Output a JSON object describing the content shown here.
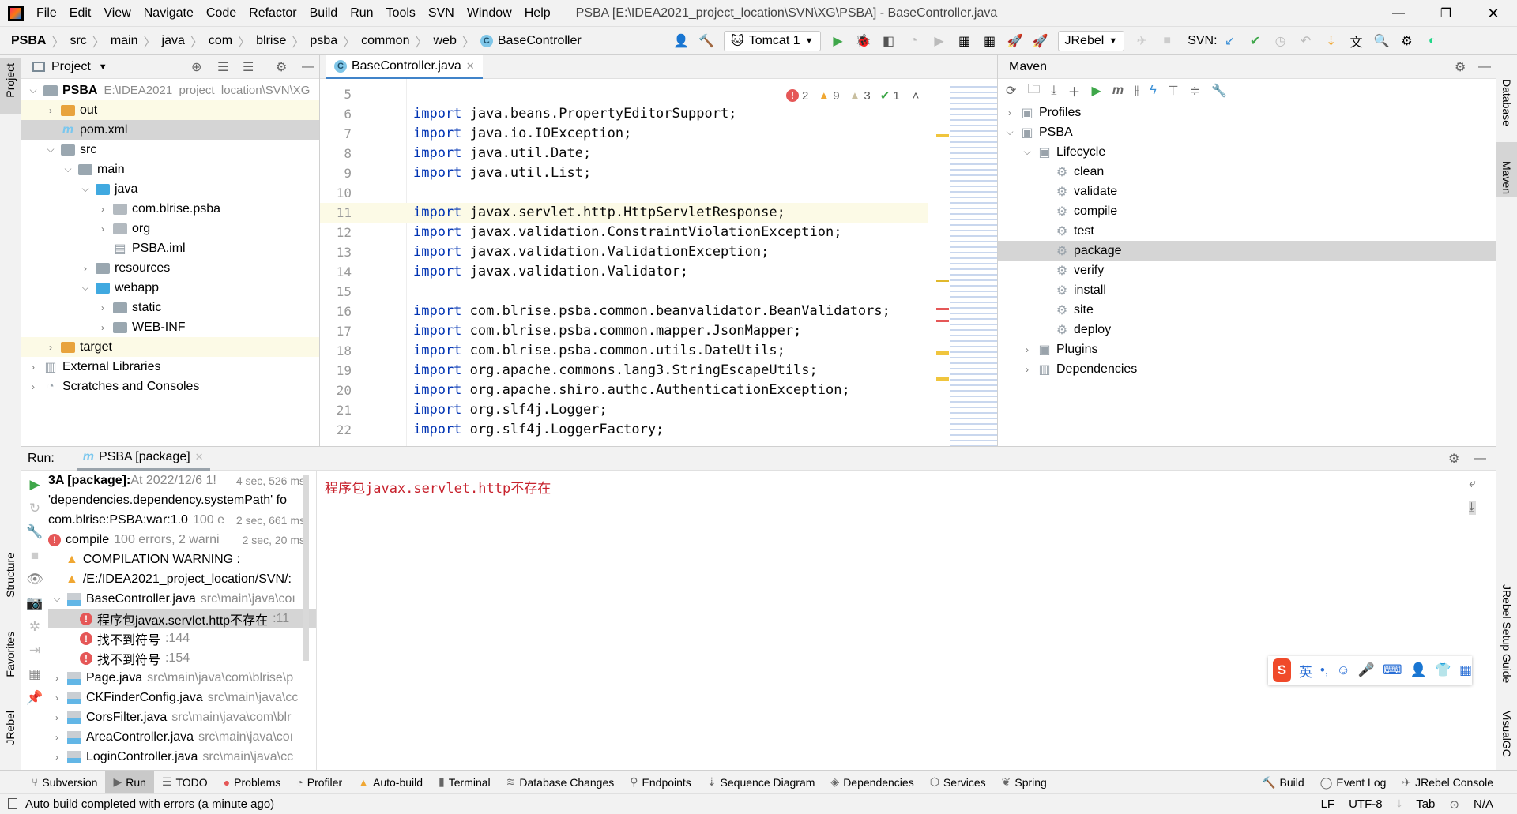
{
  "menu": {
    "items": [
      "File",
      "Edit",
      "View",
      "Navigate",
      "Code",
      "Refactor",
      "Build",
      "Run",
      "Tools",
      "SVN",
      "Window",
      "Help"
    ],
    "window_title": "PSBA [E:\\IDEA2021_project_location\\SVN\\XG\\PSBA] - BaseController.java"
  },
  "breadcrumb": [
    "PSBA",
    "src",
    "main",
    "java",
    "com",
    "blrise",
    "psba",
    "common",
    "web",
    "BaseController"
  ],
  "toolbar": {
    "run_config": "Tomcat 1",
    "jrebel": "JRebel",
    "svn_label": "SVN:"
  },
  "stripes": {
    "left": [
      "Project",
      "Structure",
      "Favorites",
      "JRebel"
    ],
    "right": [
      "Database",
      "Maven",
      "JRebel Setup Guide",
      "VisualGC"
    ]
  },
  "project": {
    "title": "Project",
    "tree": [
      {
        "label": "PSBA",
        "hint": "E:\\IDEA2021_project_location\\SVN\\XG",
        "depth": 0,
        "open": true,
        "icon": "module"
      },
      {
        "label": "out",
        "depth": 1,
        "open": false,
        "icon": "folder-orange"
      },
      {
        "label": "pom.xml",
        "depth": 1,
        "icon": "maven-file",
        "selected": true
      },
      {
        "label": "src",
        "depth": 1,
        "open": true,
        "icon": "folder"
      },
      {
        "label": "main",
        "depth": 2,
        "open": true,
        "icon": "folder"
      },
      {
        "label": "java",
        "depth": 3,
        "open": true,
        "icon": "folder-blue"
      },
      {
        "label": "com.blrise.psba",
        "depth": 4,
        "open": false,
        "icon": "package"
      },
      {
        "label": "org",
        "depth": 4,
        "open": false,
        "icon": "package"
      },
      {
        "label": "PSBA.iml",
        "depth": 4,
        "icon": "iml-file"
      },
      {
        "label": "resources",
        "depth": 3,
        "open": false,
        "icon": "folder"
      },
      {
        "label": "webapp",
        "depth": 3,
        "open": true,
        "icon": "folder-web"
      },
      {
        "label": "static",
        "depth": 4,
        "open": false,
        "icon": "folder"
      },
      {
        "label": "WEB-INF",
        "depth": 4,
        "open": false,
        "icon": "folder"
      },
      {
        "label": "target",
        "depth": 1,
        "open": false,
        "icon": "folder-orange"
      },
      {
        "label": "External Libraries",
        "depth": 0,
        "open": false,
        "icon": "libraries"
      },
      {
        "label": "Scratches and Consoles",
        "depth": 0,
        "open": false,
        "icon": "scratches"
      }
    ]
  },
  "editor": {
    "tab": "BaseController.java",
    "inspections": {
      "errors": "2",
      "warnings": "9",
      "weak_warnings": "3",
      "ok": "1"
    },
    "lines": [
      {
        "n": "5",
        "kw": "",
        "rest": ""
      },
      {
        "n": "6",
        "kw": "import",
        "rest": " java.beans.PropertyEditorSupport;"
      },
      {
        "n": "7",
        "kw": "import",
        "rest": " java.io.IOException;"
      },
      {
        "n": "8",
        "kw": "import",
        "rest": " java.util.Date;"
      },
      {
        "n": "9",
        "kw": "import",
        "rest": " java.util.List;"
      },
      {
        "n": "10",
        "kw": "",
        "rest": ""
      },
      {
        "n": "11",
        "kw": "import",
        "rest": " javax.servlet.http.HttpServletResponse;"
      },
      {
        "n": "12",
        "kw": "import",
        "rest": " javax.validation.ConstraintViolationException;"
      },
      {
        "n": "13",
        "kw": "import",
        "rest": " javax.validation.ValidationException;"
      },
      {
        "n": "14",
        "kw": "import",
        "rest": " javax.validation.Validator;"
      },
      {
        "n": "15",
        "kw": "",
        "rest": ""
      },
      {
        "n": "16",
        "kw": "import",
        "rest": " com.blrise.psba.common.beanvalidator.BeanValidators;"
      },
      {
        "n": "17",
        "kw": "import",
        "rest": " com.blrise.psba.common.mapper.JsonMapper;"
      },
      {
        "n": "18",
        "kw": "import",
        "rest": " com.blrise.psba.common.utils.DateUtils;"
      },
      {
        "n": "19",
        "kw": "import",
        "rest": " org.apache.commons.lang3.StringEscapeUtils;"
      },
      {
        "n": "20",
        "kw": "import",
        "rest": " org.apache.shiro.authc.AuthenticationException;"
      },
      {
        "n": "21",
        "kw": "import",
        "rest": " org.slf4j.Logger;"
      },
      {
        "n": "22",
        "kw": "import",
        "rest": " org.slf4j.LoggerFactory;"
      }
    ]
  },
  "maven": {
    "title": "Maven",
    "tree": [
      {
        "label": "Profiles",
        "depth": 0,
        "open": false,
        "icon": "profiles"
      },
      {
        "label": "PSBA",
        "depth": 0,
        "open": true,
        "icon": "maven-module"
      },
      {
        "label": "Lifecycle",
        "depth": 1,
        "open": true,
        "icon": "lifecycle"
      },
      {
        "label": "clean",
        "depth": 2,
        "icon": "gear"
      },
      {
        "label": "validate",
        "depth": 2,
        "icon": "gear"
      },
      {
        "label": "compile",
        "depth": 2,
        "icon": "gear"
      },
      {
        "label": "test",
        "depth": 2,
        "icon": "gear"
      },
      {
        "label": "package",
        "depth": 2,
        "icon": "gear",
        "selected": true
      },
      {
        "label": "verify",
        "depth": 2,
        "icon": "gear"
      },
      {
        "label": "install",
        "depth": 2,
        "icon": "gear"
      },
      {
        "label": "site",
        "depth": 2,
        "icon": "gear"
      },
      {
        "label": "deploy",
        "depth": 2,
        "icon": "gear"
      },
      {
        "label": "Plugins",
        "depth": 1,
        "open": false,
        "icon": "plugins"
      },
      {
        "label": "Dependencies",
        "depth": 1,
        "open": false,
        "icon": "dependencies"
      }
    ]
  },
  "run": {
    "label": "Run:",
    "tab": "PSBA [package]",
    "output": "程序包javax.servlet.http不存在",
    "tree": [
      {
        "bold": "3A [package]:",
        "text": " At 2022/12/6 1!",
        "time": "4 sec, 526 ms",
        "depth": 0
      },
      {
        "text": "'dependencies.dependency.systemPath' fo",
        "depth": 0
      },
      {
        "text": "com.blrise:PSBA:war:1.0",
        "hint": "100 e",
        "time": "2 sec, 661 ms",
        "depth": 0
      },
      {
        "text": "compile",
        "hint": "100 errors, 2 warni",
        "time": "2 sec, 20 ms",
        "depth": 0,
        "icon": "error"
      },
      {
        "text": "COMPILATION WARNING :",
        "depth": 1,
        "icon": "warning"
      },
      {
        "text": "/E:/IDEA2021_project_location/SVN/:",
        "depth": 1,
        "icon": "warning"
      },
      {
        "text": "BaseController.java",
        "hint": "src\\main\\java\\coı",
        "depth": 1,
        "icon": "java-file",
        "open": true
      },
      {
        "text": "程序包javax.servlet.http不存在",
        "hint": ":11",
        "depth": 2,
        "icon": "error",
        "selected": true
      },
      {
        "text": "找不到符号",
        "hint": ":144",
        "depth": 2,
        "icon": "error"
      },
      {
        "text": "找不到符号",
        "hint": ":154",
        "depth": 2,
        "icon": "error"
      },
      {
        "text": "Page.java",
        "hint": "src\\main\\java\\com\\blrise\\p",
        "depth": 1,
        "icon": "java-file",
        "open": false
      },
      {
        "text": "CKFinderConfig.java",
        "hint": "src\\main\\java\\cc",
        "depth": 1,
        "icon": "java-file",
        "open": false
      },
      {
        "text": "CorsFilter.java",
        "hint": "src\\main\\java\\com\\blr",
        "depth": 1,
        "icon": "java-file",
        "open": false
      },
      {
        "text": "AreaController.java",
        "hint": "src\\main\\java\\coı",
        "depth": 1,
        "icon": "java-file",
        "open": false
      },
      {
        "text": "LoginController.java",
        "hint": "src\\main\\java\\cc",
        "depth": 1,
        "icon": "java-file",
        "open": false
      }
    ]
  },
  "tool_windows": {
    "left": [
      "Subversion",
      "Run",
      "TODO",
      "Problems",
      "Profiler",
      "Auto-build",
      "Terminal",
      "Database Changes",
      "Endpoints",
      "Sequence Diagram",
      "Dependencies",
      "Services",
      "Spring"
    ],
    "right": [
      "Build",
      "Event Log",
      "JRebel Console"
    ],
    "active": "Run"
  },
  "ime": {
    "lang": "英"
  },
  "status": {
    "message": "Auto build completed with errors (a minute ago)",
    "line_sep": "LF",
    "encoding": "UTF-8",
    "indent": "Tab",
    "vcs": "N/A"
  },
  "colors": {
    "accent": "#4083c9",
    "error": "#e55757",
    "warning": "#f0a732",
    "selection": "#d5d5d5",
    "keyword": "#0033b3",
    "output_error": "#c7222d"
  }
}
